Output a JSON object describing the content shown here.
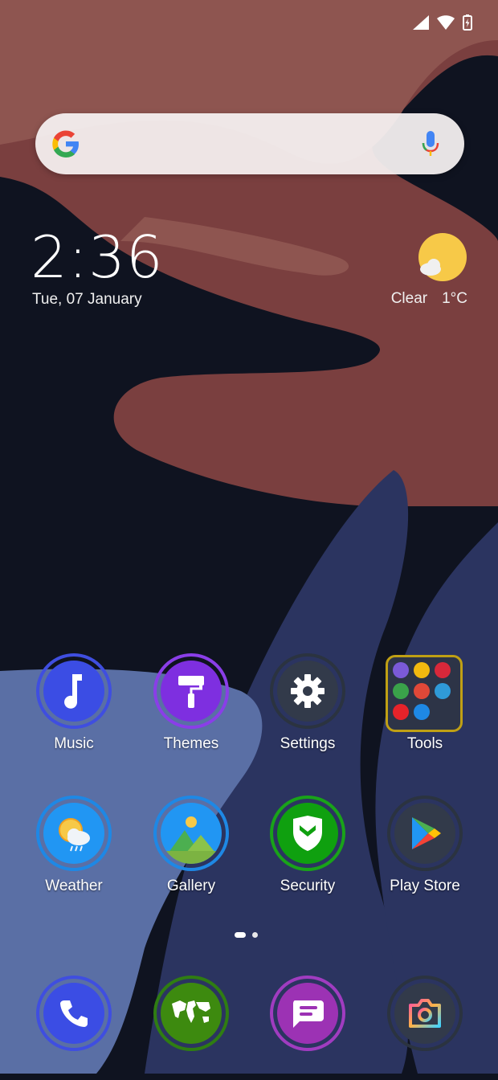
{
  "status_bar": {
    "icons": [
      "signal-icon",
      "wifi-icon",
      "battery-charging-icon"
    ]
  },
  "search_bar": {
    "icons": [
      "google-logo-icon",
      "microphone-icon"
    ]
  },
  "clock": {
    "time": "2:36",
    "date": "Tue, 07 January"
  },
  "weather": {
    "condition": "Clear",
    "temperature": "1°C",
    "icon": "sun-cloud-icon"
  },
  "apps_row1": [
    {
      "label": "Music",
      "icon": "music-note-icon",
      "ring": "#3f4ee0"
    },
    {
      "label": "Themes",
      "icon": "paint-roller-icon",
      "ring": "#8a3ee8"
    },
    {
      "label": "Settings",
      "icon": "gear-icon",
      "ring": "#2b3340"
    },
    {
      "label": "Tools",
      "icon": "folder-icon",
      "ring": "#c0a014"
    }
  ],
  "apps_row2": [
    {
      "label": "Weather",
      "icon": "weather-icon",
      "ring": "#1e88e5"
    },
    {
      "label": "Gallery",
      "icon": "gallery-icon",
      "ring": "#1e88e5"
    },
    {
      "label": "Security",
      "icon": "shield-icon",
      "ring": "#19a319"
    },
    {
      "label": "Play Store",
      "icon": "play-store-icon",
      "ring": "#2b3340"
    }
  ],
  "dock": [
    {
      "name": "phone",
      "icon": "phone-icon",
      "ring": "#3f4ee0"
    },
    {
      "name": "browser",
      "icon": "world-map-icon",
      "ring": "#2f7d12"
    },
    {
      "name": "messages",
      "icon": "message-icon",
      "ring": "#a03cc0"
    },
    {
      "name": "camera",
      "icon": "camera-icon",
      "ring": "#2b3340"
    }
  ],
  "page_indicator": {
    "pages": 2,
    "current": 1
  },
  "colors": {
    "wallpaper_dark": "#0f1320",
    "wallpaper_brown": "#7b4040",
    "wallpaper_blue": "#2b3460",
    "wallpaper_lightblue": "#5a6fa5"
  }
}
